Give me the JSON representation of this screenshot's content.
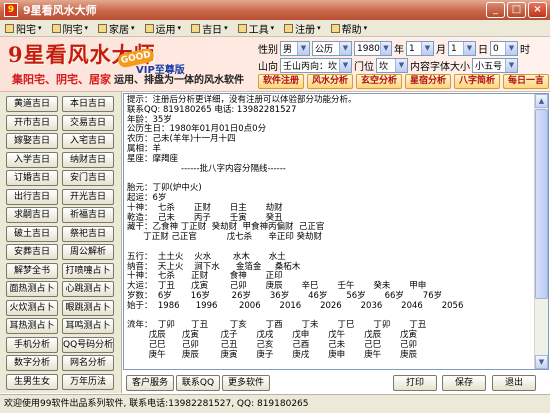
{
  "window": {
    "title": "9星看风水大师",
    "minimize": "_",
    "maximize": "□",
    "close": "×"
  },
  "menu": [
    "阳宅",
    "阴宅",
    "家居",
    "运用",
    "吉日",
    "工具",
    "注册",
    "帮助"
  ],
  "banner": {
    "logo_main": "9星看风水大师",
    "logo_badge": "GOOD",
    "logo_vip": "VIP至尊版",
    "slogan_left": "集阳宅、阴宅、居家",
    "slogan_right": "运用、排盘为一体的风水软件"
  },
  "form": {
    "gender_label": "性别",
    "gender": "男",
    "calendar": "公历",
    "year": "1980",
    "year_unit": "年",
    "month": "1",
    "month_unit": "月",
    "day": "1",
    "day_unit": "日",
    "hour": "0",
    "hour_unit": "时",
    "mountain_label": "山向",
    "mountain": "壬山丙向：坎",
    "door_label": "门位",
    "door": "坎",
    "house_label": "内容字体大小",
    "font_size": "小五号"
  },
  "top_buttons": [
    "软件注册",
    "风水分析",
    "玄空分析",
    "星宿分析",
    "八字简析",
    "每日一言"
  ],
  "sidebar_buttons": [
    [
      "黄道吉日",
      "本日吉日"
    ],
    [
      "开市吉日",
      "交易吉日"
    ],
    [
      "嫁娶吉日",
      "入宅吉日"
    ],
    [
      "入学吉日",
      "纳财吉日"
    ],
    [
      "订婚吉日",
      "安门吉日"
    ],
    [
      "出行吉日",
      "开光吉日"
    ],
    [
      "求嗣吉日",
      "祈福吉日"
    ],
    [
      "破土吉日",
      "祭祀吉日"
    ],
    [
      "安葬吉日",
      "周公解析"
    ],
    [
      "解梦全书",
      "打喷嚏占卜"
    ],
    [
      "面热测占卜",
      "心跳测占卜"
    ],
    [
      "火炊测占卜",
      "眼跳测占卜"
    ],
    [
      "耳热测占卜",
      "耳鸣测占卜"
    ],
    [
      "手机分析",
      "QQ号码分析"
    ],
    [
      "数字分析",
      "网名分析"
    ],
    [
      "生男生女",
      "万年历法"
    ]
  ],
  "content_lines": [
    "提示：注册后分析更详细，没有注册可以体验部分功能分析。",
    "联系QQ: 819180265 电话: 13982281527",
    "年龄：35岁",
    "公历生日：1980年01月01日0点0分",
    "农历：己未(羊年)十一月十四",
    "属相：羊",
    "星座：摩羯座",
    "                    ------批八字内容分隔线------",
    "",
    "胎元：丁卯(炉中火)",
    "起运：6岁",
    "十神：  七杀       正财       日主       劫财",
    "乾造：  己未       丙子       壬寅       癸丑",
    "藏干：乙食神 丁正财  癸劫财  甲食神丙偏财  己正官",
    "      丁正财 己正官           戊七杀      辛正印 癸劫财",
    "",
    "五行：  土土火    火水        水木       水土",
    "纳音：  天上火    涧下水      金箔金     桑柘木",
    "十神：  七杀      正财        食神       正印",
    "大运：  丁丑      戊寅        己卯       庚辰       辛巳       壬午       癸未       甲申",
    "岁数：  6岁       16岁        26岁       36岁       46岁       56岁       66岁       76岁",
    "始于：  1986      1996        2006       2016       2026       2036       2046       2056",
    "",
    "流年：  丁卯      丁丑        丁亥       丁酉       丁未       丁巳       丁卯       丁丑",
    "        戊辰      戊寅        戊子       戊戌       戊申       戊午       戊辰       戊寅",
    "        己巳      己卯        己丑       己亥       己酉       己未       己巳       己卯",
    "        庚午      庚辰        庚寅       庚子       庚戌       庚申       庚午       庚辰"
  ],
  "bottom_buttons": {
    "service": "客户服务",
    "qq": "联系QQ",
    "more": "更多软件",
    "print": "打印",
    "save": "保存",
    "exit": "退出"
  },
  "status": "欢迎使用99软件出品系列软件, 联系电话:13982281527, QQ: 819180265"
}
